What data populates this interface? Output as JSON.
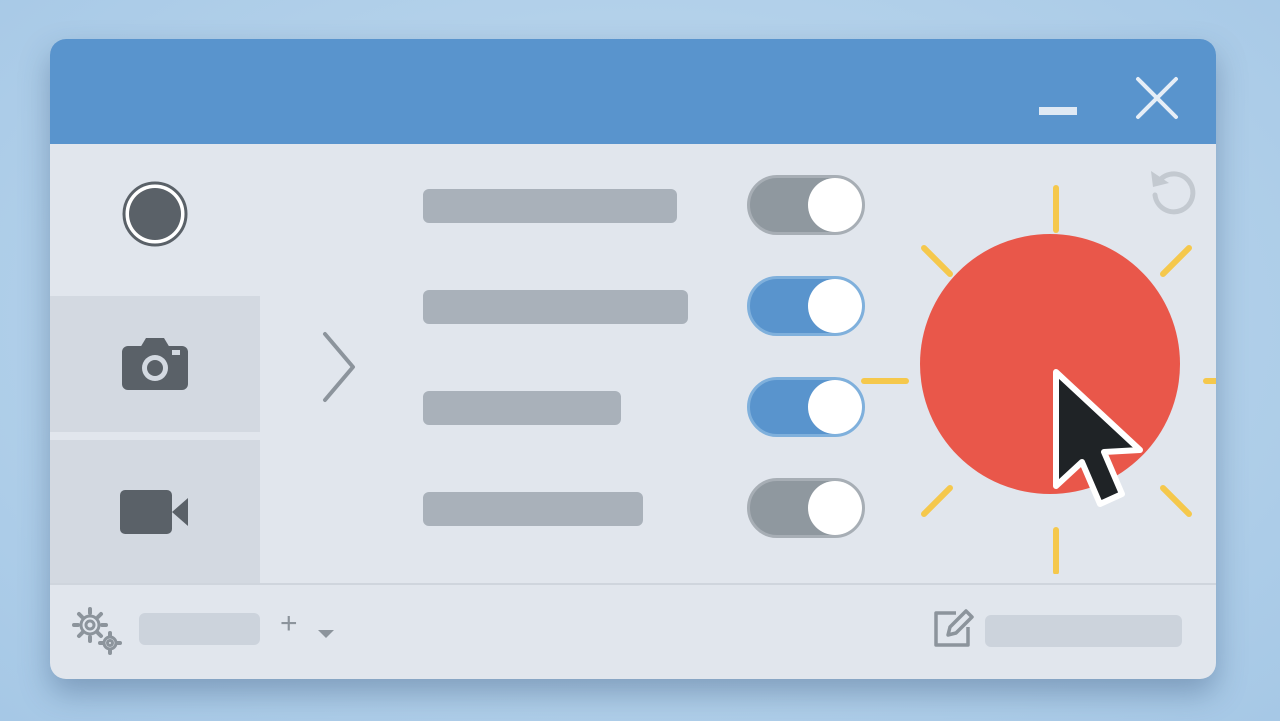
{
  "window": {
    "accent_color": "#5994cd",
    "minimize_icon": "minimize-icon",
    "close_icon": "close-icon"
  },
  "sidebar": {
    "items": [
      {
        "name": "record",
        "icon": "record-icon",
        "active": false
      },
      {
        "name": "screenshot",
        "icon": "camera-icon",
        "active": true
      },
      {
        "name": "video",
        "icon": "video-camera-icon",
        "active": true
      }
    ],
    "expand_icon": "chevron-right-icon"
  },
  "settings_rows": [
    {
      "toggle_on": false
    },
    {
      "toggle_on": true
    },
    {
      "toggle_on": true
    },
    {
      "toggle_on": false
    }
  ],
  "colors": {
    "toggle_on": "#5994cd",
    "toggle_off": "#8f989f",
    "record_button": "#e9574a",
    "glow": "#f5c84c"
  },
  "main": {
    "reset_icon": "reset-icon",
    "record_button_icon": "record-button",
    "cursor_icon": "cursor-icon"
  },
  "footer": {
    "settings_icon": "gears-icon",
    "add_label": "+",
    "dropdown_icon": "caret-down-icon",
    "edit_icon": "edit-icon"
  }
}
